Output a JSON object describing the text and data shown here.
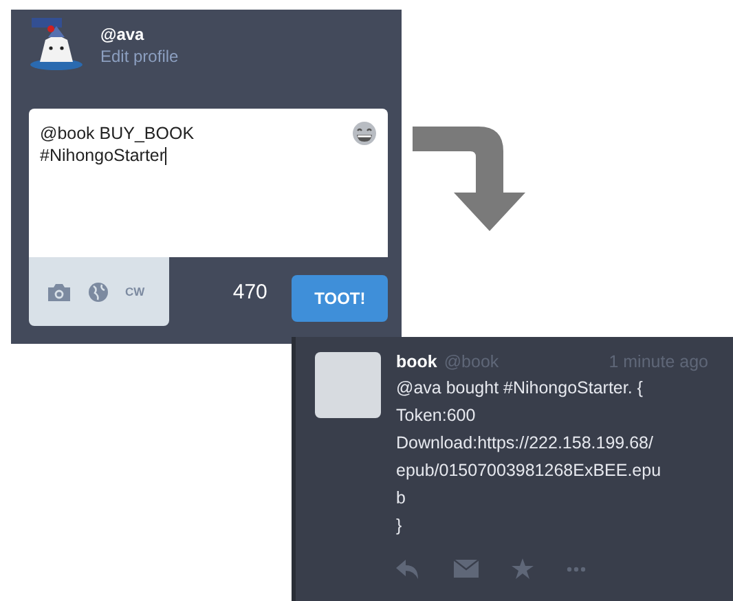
{
  "compose": {
    "user": {
      "handle": "@ava",
      "link": "Edit profile"
    },
    "text_lines": [
      "@book BUY_BOOK",
      "#NihongoStarter"
    ],
    "cw_label": "CW",
    "char_count": "470",
    "submit": "TOOT!"
  },
  "status": {
    "name": "book",
    "handle": "@book",
    "time": "1 minute ago",
    "lines": [
      "@ava bought #NihongoStarter. {",
      "Token:600",
      "Download:https://222.158.199.68/",
      "epub/01507003981268ExBEE.epu",
      "b",
      "}"
    ]
  }
}
